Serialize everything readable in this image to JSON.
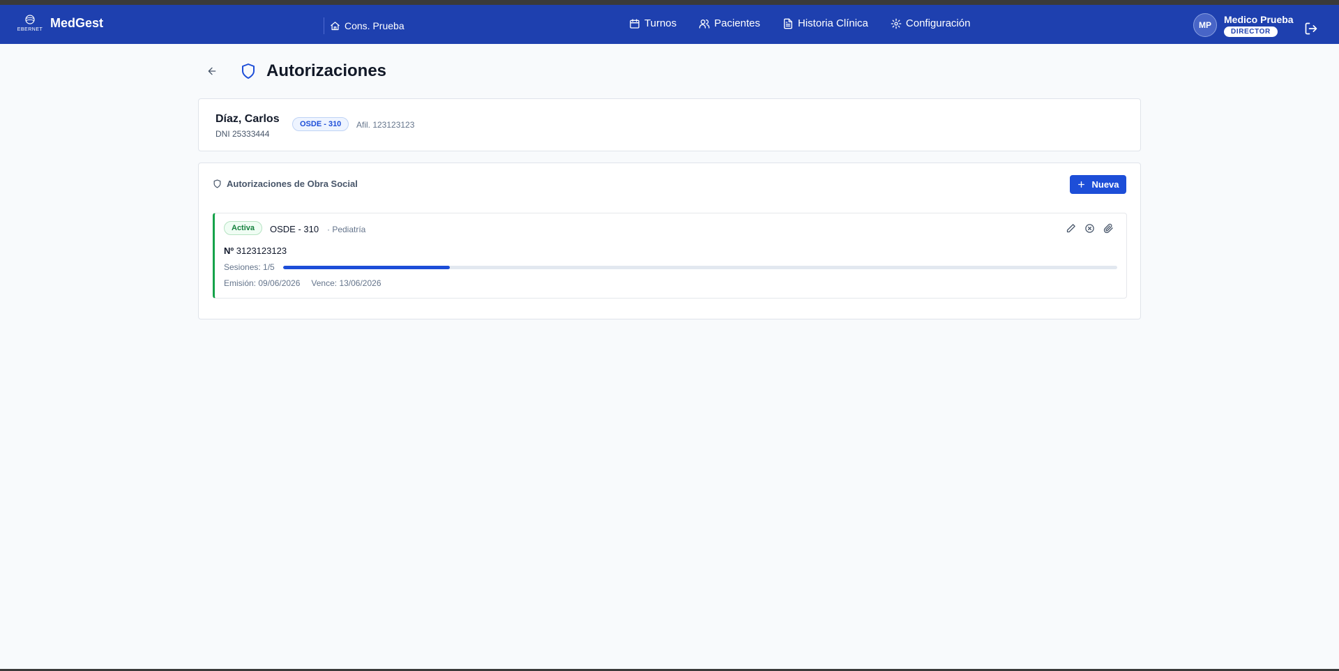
{
  "header": {
    "logo_text": "EBERNET",
    "brand": "MedGest",
    "clinic": "Cons. Prueba",
    "nav": [
      {
        "label": "Turnos",
        "icon": "calendar-icon"
      },
      {
        "label": "Pacientes",
        "icon": "users-icon"
      },
      {
        "label": "Historia Clínica",
        "icon": "file-text-icon"
      },
      {
        "label": "Configuración",
        "icon": "gear-icon"
      }
    ],
    "user": {
      "initials": "MP",
      "name": "Medico Prueba",
      "role": "DIRECTOR"
    }
  },
  "page": {
    "title": "Autorizaciones"
  },
  "patient": {
    "name": "Díaz, Carlos",
    "dni": "DNI 25333444",
    "obra_social": "OSDE - 310",
    "afiliado": "Afil. 123123123"
  },
  "authorizations": {
    "title": "Autorizaciones de Obra Social",
    "new_label": "Nueva",
    "items": [
      {
        "status": "Activa",
        "obra_social": "OSDE - 310",
        "specialty": "· Pediatría",
        "number_label": "Nº",
        "number": "3123123123",
        "sessions_text": "Sesiones: 1/5",
        "sessions_used": 1,
        "sessions_total": 5,
        "emission": "Emisión: 09/06/2026",
        "expiry": "Vence: 13/06/2026"
      }
    ]
  },
  "colors": {
    "nav_bg": "#1e40af",
    "accent": "#1d4ed8",
    "active_green": "#16a34a"
  }
}
